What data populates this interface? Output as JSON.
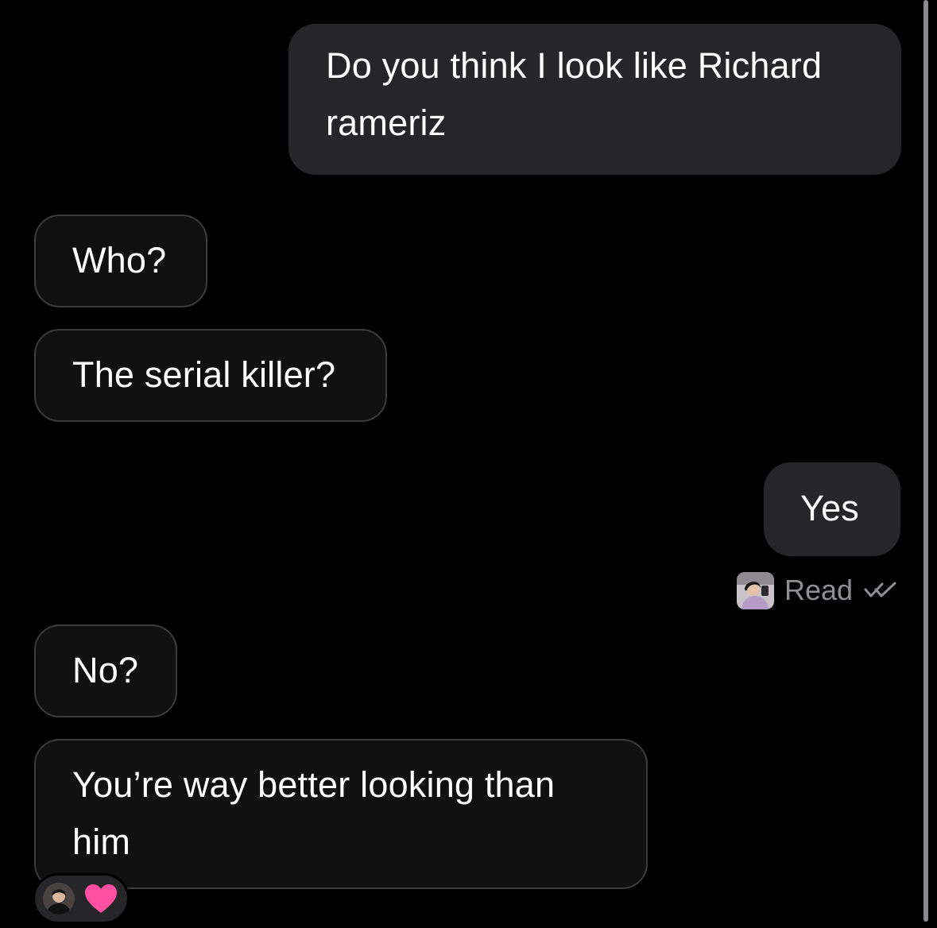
{
  "conversation": {
    "messages": [
      {
        "direction": "outgoing",
        "text": "Do you think I look like Richard rameriz"
      },
      {
        "direction": "incoming",
        "text": "Who?"
      },
      {
        "direction": "incoming",
        "text": "The serial killer?"
      },
      {
        "direction": "outgoing",
        "text": "Yes"
      },
      {
        "direction": "incoming",
        "text": "No?"
      },
      {
        "direction": "incoming",
        "text": "You’re way better looking than him"
      }
    ],
    "read_receipt": {
      "label": "Read",
      "icon": "double-check-icon"
    },
    "reaction": {
      "emoji": "heart",
      "icon": "heart-icon",
      "color": "#ff4fa3"
    }
  },
  "colors": {
    "background": "#000000",
    "outgoing_bubble": "#262628",
    "incoming_bubble": "#101010",
    "incoming_border": "#3c3c3e",
    "muted_text": "#8e8e93"
  }
}
